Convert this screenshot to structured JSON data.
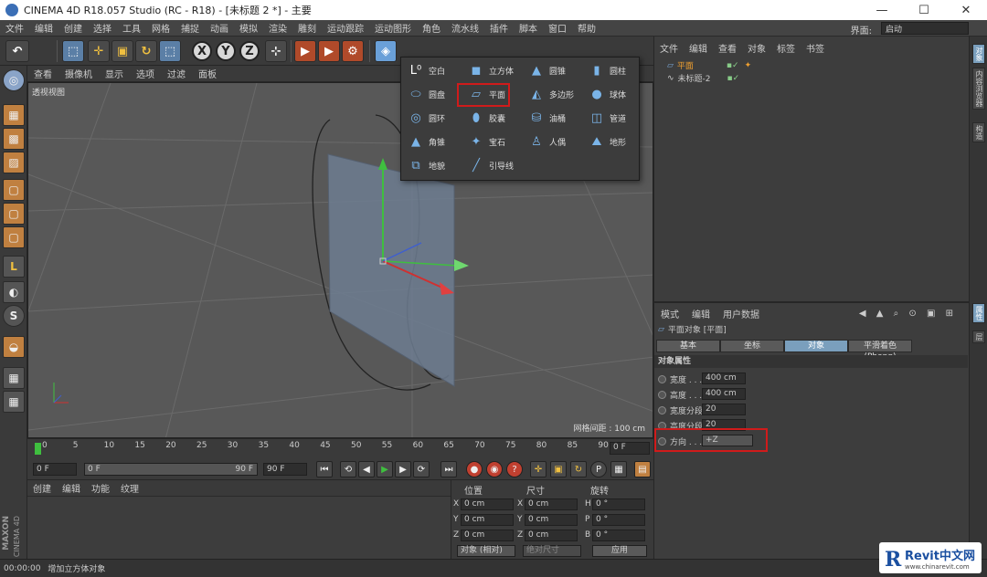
{
  "window": {
    "title": "CINEMA 4D R18.057 Studio (RC - R18) - [未标题 2 *] - 主要",
    "minimize": "—",
    "maximize": "☐",
    "close": "✕"
  },
  "menubar": {
    "items": [
      "文件",
      "编辑",
      "创建",
      "选择",
      "工具",
      "网格",
      "捕捉",
      "动画",
      "模拟",
      "渲染",
      "雕刻",
      "运动跟踪",
      "运动图形",
      "角色",
      "流水线",
      "插件",
      "脚本",
      "窗口",
      "帮助"
    ],
    "layout_label": "界面:",
    "layout_value": "启动"
  },
  "toolbar": {
    "x_label": "X",
    "y_label": "Y",
    "z_label": "Z"
  },
  "viewport": {
    "menu": [
      "查看",
      "摄像机",
      "显示",
      "选项",
      "过滤",
      "面板"
    ],
    "label": "透视视图",
    "grid_spacing": "网格间距 : 100 cm"
  },
  "popup": {
    "items": [
      {
        "label": "空白",
        "icon": "null-icon"
      },
      {
        "label": "立方体",
        "icon": "cube-icon"
      },
      {
        "label": "圆锥",
        "icon": "cone-icon"
      },
      {
        "label": "圆柱",
        "icon": "cylinder-icon"
      },
      {
        "label": "圆盘",
        "icon": "disc-icon"
      },
      {
        "label": "平面",
        "icon": "plane-icon"
      },
      {
        "label": "多边形",
        "icon": "polygon-icon"
      },
      {
        "label": "球体",
        "icon": "sphere-icon"
      },
      {
        "label": "圆环",
        "icon": "torus-icon"
      },
      {
        "label": "胶囊",
        "icon": "capsule-icon"
      },
      {
        "label": "油桶",
        "icon": "oil-tank-icon"
      },
      {
        "label": "管道",
        "icon": "tube-icon"
      },
      {
        "label": "角锥",
        "icon": "pyramid-icon"
      },
      {
        "label": "宝石",
        "icon": "platonic-icon"
      },
      {
        "label": "人偶",
        "icon": "figure-icon"
      },
      {
        "label": "地形",
        "icon": "landscape-icon"
      },
      {
        "label": "地貌",
        "icon": "relief-icon"
      },
      {
        "label": "引导线",
        "icon": "guide-icon"
      }
    ]
  },
  "timeline": {
    "ticks": [
      "0",
      "5",
      "10",
      "15",
      "20",
      "25",
      "30",
      "35",
      "40",
      "45",
      "50",
      "55",
      "60",
      "65",
      "70",
      "75",
      "80",
      "85",
      "90"
    ],
    "current_frame": "0 F"
  },
  "playbar": {
    "start": "0 F",
    "min": "0 F",
    "max": "90 F",
    "end": "90 F"
  },
  "material": {
    "menu": [
      "创建",
      "编辑",
      "功能",
      "纹理"
    ]
  },
  "coords": {
    "headers": [
      "位置",
      "尺寸",
      "旋转"
    ],
    "rows": [
      {
        "pl": "X",
        "pv": "0 cm",
        "sl": "X",
        "sv": "0 cm",
        "rl": "H",
        "rv": "0 °"
      },
      {
        "pl": "Y",
        "pv": "0 cm",
        "sl": "Y",
        "sv": "0 cm",
        "rl": "P",
        "rv": "0 °"
      },
      {
        "pl": "Z",
        "pv": "0 cm",
        "sl": "Z",
        "sv": "0 cm",
        "rl": "B",
        "rv": "0 °"
      }
    ],
    "mode": "对象 (相对)",
    "size_mode": "绝对尺寸",
    "apply": "应用"
  },
  "object_manager": {
    "menu": [
      "文件",
      "编辑",
      "查看",
      "对象",
      "标签",
      "书签"
    ],
    "objects": [
      {
        "name": "平面"
      },
      {
        "name": "未标题-2"
      }
    ]
  },
  "attribute_manager": {
    "menu": [
      "模式",
      "编辑",
      "用户数据"
    ],
    "object_title": "平面对象 [平面]",
    "tabs": [
      "基本",
      "坐标",
      "对象",
      "平滑着色(Phong)"
    ],
    "section": "对象属性",
    "props": [
      {
        "label": "宽度 . . .",
        "value": "400 cm"
      },
      {
        "label": "高度 . . .",
        "value": "400 cm"
      },
      {
        "label": "宽度分段",
        "value": "20"
      },
      {
        "label": "高度分段",
        "value": "20"
      },
      {
        "label": "方向 . . .",
        "value": "+Z"
      }
    ]
  },
  "side_tabs": [
    "对象",
    "内容浏览器",
    "构造",
    "属性",
    "层"
  ],
  "status": {
    "time": "00:00:00",
    "message": "增加立方体对象"
  },
  "branding": {
    "maxon": "MAXON",
    "cinema": "CINEMA 4D"
  },
  "watermark": {
    "brand": "Revit中文网",
    "url": "www.chinarevit.com"
  },
  "colors": {
    "highlight": "#d01b1b",
    "active_tab": "#7a9fbd",
    "viewport_bg": "#585858"
  }
}
